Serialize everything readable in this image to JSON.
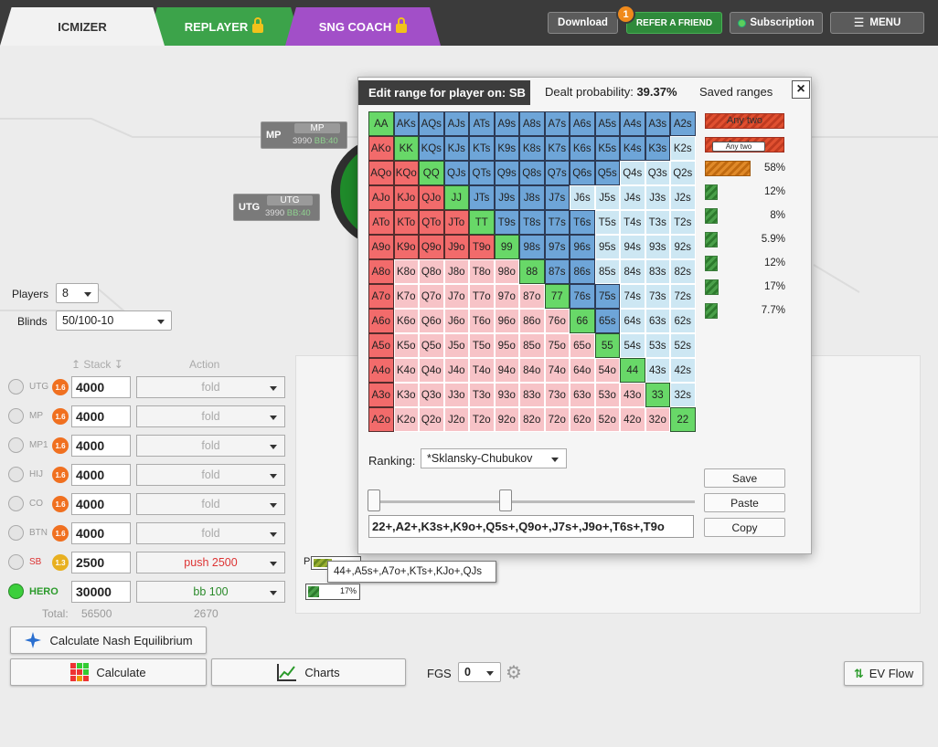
{
  "tabs": [
    {
      "label": "ICMIZER",
      "locked": false
    },
    {
      "label": "REPLAYER",
      "locked": true
    },
    {
      "label": "SNG COACH",
      "locked": true
    }
  ],
  "topbar": {
    "download": "Download",
    "refer": "REFER A FRIEND",
    "refer_badge": "1",
    "subscription": "Subscription",
    "menu": "MENU"
  },
  "seats": [
    {
      "pos": "MP",
      "name": "MP",
      "stack": "3990",
      "bb": "BB:40"
    },
    {
      "pos": "UTG",
      "name": "UTG",
      "stack": "3990",
      "bb": "BB:40"
    }
  ],
  "settings": {
    "players_label": "Players",
    "players_value": "8",
    "blinds_label": "Blinds",
    "blinds_value": "50/100-10",
    "stack_header": "Stack",
    "action_header": "Action",
    "total_label": "Total:",
    "total_stack": "56500",
    "total_action": "2670"
  },
  "player_rows": [
    {
      "pos": "UTG",
      "orb": "1.6",
      "stack": "4000",
      "action": "fold",
      "kind": "fold"
    },
    {
      "pos": "MP",
      "orb": "1.6",
      "stack": "4000",
      "action": "fold",
      "kind": "fold"
    },
    {
      "pos": "MP1",
      "orb": "1.6",
      "stack": "4000",
      "action": "fold",
      "kind": "fold"
    },
    {
      "pos": "HIJ",
      "orb": "1.6",
      "stack": "4000",
      "action": "fold",
      "kind": "fold"
    },
    {
      "pos": "CO",
      "orb": "1.6",
      "stack": "4000",
      "action": "fold",
      "kind": "fold"
    },
    {
      "pos": "BTN",
      "orb": "1.6",
      "stack": "4000",
      "action": "fold",
      "kind": "fold"
    },
    {
      "pos": "SB",
      "orb": "1.3",
      "stack": "2500",
      "action": "push 2500",
      "kind": "push"
    },
    {
      "pos": "HERO",
      "orb": "",
      "stack": "30000",
      "action": "bb 100",
      "kind": "bb"
    }
  ],
  "buttons": {
    "nash": "Calculate Nash Equilibrium",
    "calculate": "Calculate",
    "charts": "Charts",
    "fgs_label": "FGS",
    "fgs_value": "0",
    "evflow": "EV Flow"
  },
  "dialog": {
    "title": "Edit range for player on: SB",
    "dealt_label": "Dealt probability:",
    "dealt_value": "39.37%",
    "saved_ranges": "Saved ranges",
    "close": "×",
    "ranking_label": "Ranking:",
    "ranking_value": "*Sklansky-Chubukov",
    "range_text": "22+,A2+,K3s+,K9o+,Q5s+,Q9o+,J7s+,J9o+,T6s+,T9o",
    "save": "Save",
    "paste": "Paste",
    "copy": "Copy",
    "tooltip": "Any two"
  },
  "saved_ranges": [
    {
      "name": "Any two",
      "pct": "",
      "fill": 1.0,
      "color": "red"
    },
    {
      "name": "Any two",
      "pct": "",
      "fill": 1.0,
      "color": "red"
    },
    {
      "name": "",
      "pct": "58%",
      "fill": 0.58,
      "color": "orange"
    },
    {
      "name": "",
      "pct": "12%",
      "fill": 0.12,
      "color": "green"
    },
    {
      "name": "",
      "pct": "8%",
      "fill": 0.08,
      "color": "green"
    },
    {
      "name": "",
      "pct": "5.9%",
      "fill": 0.06,
      "color": "green"
    },
    {
      "name": "",
      "pct": "12%",
      "fill": 0.12,
      "color": "green"
    },
    {
      "name": "",
      "pct": "17%",
      "fill": 0.17,
      "color": "green"
    },
    {
      "name": "",
      "pct": "7.7%",
      "fill": 0.08,
      "color": "green"
    }
  ],
  "below": {
    "p_label": "P",
    "tooltip": "44+,A5s+,A7o+,KTs+,KJo+,QJs",
    "bar2_pct": "17%"
  },
  "colors": {
    "suited_selected": "#6ea5d8",
    "pair_selected": "#68d868",
    "offsuit_selected": "#f26b6b",
    "suited_unselected": "#cde7f3",
    "offsuit_unselected": "#f7c3c7"
  },
  "grid": [
    [
      "AA g",
      "AKs b",
      "AQs b",
      "AJs b",
      "ATs b",
      "A9s b",
      "A8s b",
      "A7s b",
      "A6s b",
      "A5s b",
      "A4s b",
      "A3s b",
      "A2s b"
    ],
    [
      "AKo r",
      "KK g",
      "KQs b",
      "KJs b",
      "KTs b",
      "K9s b",
      "K8s b",
      "K7s b",
      "K6s b",
      "K5s b",
      "K4s b",
      "K3s b",
      "K2s lb"
    ],
    [
      "AQo r",
      "KQo r",
      "QQ g",
      "QJs b",
      "QTs b",
      "Q9s b",
      "Q8s b",
      "Q7s b",
      "Q6s b",
      "Q5s b",
      "Q4s lb",
      "Q3s lb",
      "Q2s lb"
    ],
    [
      "AJo r",
      "KJo r",
      "QJo r",
      "JJ g",
      "JTs b",
      "J9s b",
      "J8s b",
      "J7s b",
      "J6s lb",
      "J5s lb",
      "J4s lb",
      "J3s lb",
      "J2s lb"
    ],
    [
      "ATo r",
      "KTo r",
      "QTo r",
      "JTo r",
      "TT g",
      "T9s b",
      "T8s b",
      "T7s b",
      "T6s b",
      "T5s lb",
      "T4s lb",
      "T3s lb",
      "T2s lb"
    ],
    [
      "A9o r",
      "K9o r",
      "Q9o r",
      "J9o r",
      "T9o r",
      "99 g",
      "98s b",
      "97s b",
      "96s b",
      "95s lb",
      "94s lb",
      "93s lb",
      "92s lb"
    ],
    [
      "A8o r",
      "K8o lr",
      "Q8o lr",
      "J8o lr",
      "T8o lr",
      "98o lr",
      "88 g",
      "87s b",
      "86s b",
      "85s lb",
      "84s lb",
      "83s lb",
      "82s lb"
    ],
    [
      "A7o r",
      "K7o lr",
      "Q7o lr",
      "J7o lr",
      "T7o lr",
      "97o lr",
      "87o lr",
      "77 g",
      "76s b",
      "75s b",
      "74s lb",
      "73s lb",
      "72s lb"
    ],
    [
      "A6o r",
      "K6o lr",
      "Q6o lr",
      "J6o lr",
      "T6o lr",
      "96o lr",
      "86o lr",
      "76o lr",
      "66 g",
      "65s b",
      "64s lb",
      "63s lb",
      "62s lb"
    ],
    [
      "A5o r",
      "K5o lr",
      "Q5o lr",
      "J5o lr",
      "T5o lr",
      "95o lr",
      "85o lr",
      "75o lr",
      "65o lr",
      "55 g",
      "54s lb",
      "53s lb",
      "52s lb"
    ],
    [
      "A4o r",
      "K4o lr",
      "Q4o lr",
      "J4o lr",
      "T4o lr",
      "94o lr",
      "84o lr",
      "74o lr",
      "64o lr",
      "54o lr",
      "44 g",
      "43s lb",
      "42s lb"
    ],
    [
      "A3o r",
      "K3o lr",
      "Q3o lr",
      "J3o lr",
      "T3o lr",
      "93o lr",
      "83o lr",
      "73o lr",
      "63o lr",
      "53o lr",
      "43o lr",
      "33 g",
      "32s lb"
    ],
    [
      "A2o r",
      "K2o lr",
      "Q2o lr",
      "J2o lr",
      "T2o lr",
      "92o lr",
      "82o lr",
      "72o lr",
      "62o lr",
      "52o lr",
      "42o lr",
      "32o lr",
      "22 g"
    ]
  ]
}
